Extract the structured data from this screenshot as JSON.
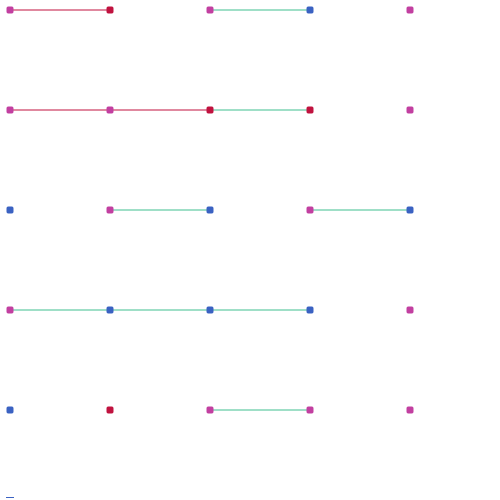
{
  "colors": {
    "background": "#ffffff",
    "dot": {
      "magenta": "#c23fa0",
      "blue": "#3a62c2",
      "red": "#c0123f"
    },
    "line": {
      "red": "#c0123f",
      "green": "#3fbf8f"
    }
  },
  "board": {
    "cols": 5,
    "rows": 5,
    "dots": [
      [
        "magenta",
        "red",
        "magenta",
        "blue",
        "magenta"
      ],
      [
        "magenta",
        "magenta",
        "red",
        "red",
        "magenta"
      ],
      [
        "blue",
        "magenta",
        "blue",
        "magenta",
        "blue"
      ],
      [
        "magenta",
        "blue",
        "blue",
        "blue",
        "magenta"
      ],
      [
        "blue",
        "red",
        "magenta",
        "magenta",
        "magenta"
      ]
    ],
    "edges": [
      {
        "from": [
          0,
          0
        ],
        "to": [
          0,
          1
        ],
        "color": "red"
      },
      {
        "from": [
          0,
          2
        ],
        "to": [
          0,
          3
        ],
        "color": "green"
      },
      {
        "from": [
          1,
          0
        ],
        "to": [
          1,
          1
        ],
        "color": "red"
      },
      {
        "from": [
          1,
          1
        ],
        "to": [
          1,
          2
        ],
        "color": "red"
      },
      {
        "from": [
          1,
          2
        ],
        "to": [
          1,
          3
        ],
        "color": "green"
      },
      {
        "from": [
          2,
          1
        ],
        "to": [
          2,
          2
        ],
        "color": "green"
      },
      {
        "from": [
          2,
          3
        ],
        "to": [
          2,
          4
        ],
        "color": "green"
      },
      {
        "from": [
          3,
          0
        ],
        "to": [
          3,
          1
        ],
        "color": "green"
      },
      {
        "from": [
          3,
          1
        ],
        "to": [
          3,
          2
        ],
        "color": "green"
      },
      {
        "from": [
          3,
          2
        ],
        "to": [
          3,
          3
        ],
        "color": "green"
      },
      {
        "from": [
          4,
          2
        ],
        "to": [
          4,
          3
        ],
        "color": "green"
      }
    ]
  },
  "cursor_color": "#3a62c2"
}
